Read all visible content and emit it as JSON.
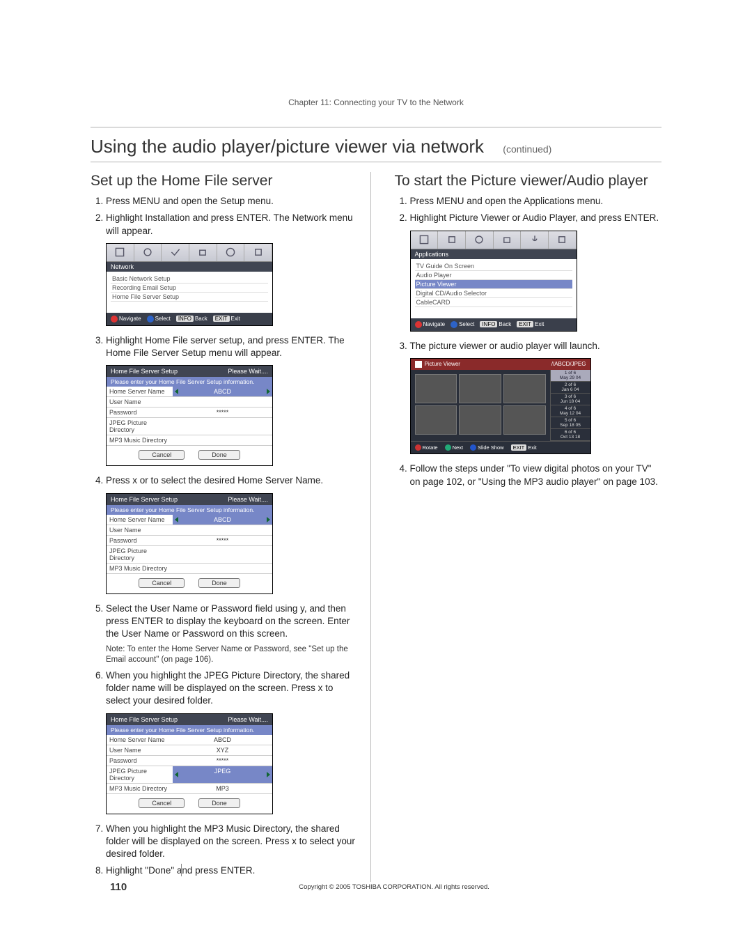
{
  "chapter": "Chapter 11: Connecting your TV to the Network",
  "title_main": "Using the audio player/picture viewer via network",
  "title_cont": "(continued)",
  "left": {
    "heading": "Set up the Home File server",
    "steps": {
      "s1": "Press MENU and open the Setup menu.",
      "s2": "Highlight Installation and press ENTER. The Network menu will appear.",
      "s3": "Highlight Home File server setup, and press ENTER. The Home File Server Setup menu will appear.",
      "s4": "Press x or  to select the desired Home Server Name.",
      "s5": "Select the User Name or Password field using y, and then press ENTER to display the keyboard on the screen. Enter the User Name or Password on this screen.",
      "s6": "When you highlight the JPEG Picture Directory, the shared folder name will be displayed on the screen. Press x to select your desired folder.",
      "s7": "When you highlight the MP3 Music Directory, the shared folder will be displayed on the screen. Press x to select your desired folder.",
      "s8": "Highlight \"Done\" and press ENTER."
    },
    "note": "Note: To enter the Home Server Name or Password, see \"Set up the Email account\" (on page 106).",
    "ui1": {
      "section": "Network",
      "items": [
        "Basic Network Setup",
        "Recording Email Setup",
        "Home File Server Setup"
      ],
      "footer": {
        "nav": "Navigate",
        "sel": "Select",
        "back_key": "INFO",
        "back": "Back",
        "exit_key": "EXIT",
        "exit": "Exit"
      }
    },
    "dlg": {
      "title": "Home File Server Setup",
      "wait": "Please Wait....",
      "sub": "Please enter your Home File Server Setup information.",
      "rows": {
        "home_server": "Home Server Name",
        "user_name": "User Name",
        "password": "Password",
        "jpeg_dir": "JPEG Picture Directory",
        "mp3_dir": "MP3 Music Directory"
      },
      "vals1": {
        "home_server": "ABCD",
        "user_name": "",
        "password": "*****",
        "jpeg_dir": "",
        "mp3_dir": ""
      },
      "vals2": {
        "home_server": "ABCD",
        "user_name": "",
        "password": "*****",
        "jpeg_dir": "",
        "mp3_dir": ""
      },
      "vals3": {
        "home_server": "ABCD",
        "user_name": "XYZ",
        "password": "*****",
        "jpeg_dir": "JPEG",
        "mp3_dir": "MP3"
      },
      "cancel": "Cancel",
      "done": "Done"
    }
  },
  "right": {
    "heading": "To start the Picture viewer/Audio player",
    "steps": {
      "s1": "Press MENU and open the Applications menu.",
      "s2": "Highlight Picture Viewer or Audio Player, and press ENTER.",
      "s3": "The picture viewer or audio player will launch.",
      "s4": "Follow the steps under \"To view digital photos on your TV\" on page 102, or \"Using the MP3 audio player\" on page 103."
    },
    "ui2": {
      "section": "Applications",
      "items": [
        "TV Guide On Screen",
        "Audio Player",
        "Picture Viewer",
        "Digital CD/Audio Selector",
        "CableCARD"
      ],
      "sel_index": 2,
      "footer": {
        "nav": "Navigate",
        "sel": "Select",
        "back_key": "INFO",
        "back": "Back",
        "exit_key": "EXIT",
        "exit": "Exit"
      }
    },
    "pv": {
      "title": "Picture Viewer",
      "path": "//ABCD/JPEG",
      "side": [
        {
          "a": "1 of 6",
          "b": "May 29 04"
        },
        {
          "a": "2 of 6",
          "b": "Jan 6 04"
        },
        {
          "a": "3 of 6",
          "b": "Jun 18 04"
        },
        {
          "a": "4 of 6",
          "b": "May 12 04"
        },
        {
          "a": "5 of 6",
          "b": "Sep 18 05"
        },
        {
          "a": "6 of 6",
          "b": "Oct 13 18"
        }
      ],
      "footer": {
        "rotate": "Rotate",
        "next": "Next",
        "slide": "Slide Show",
        "exit_key": "EXIT",
        "exit": "Exit"
      }
    }
  },
  "page_number": "110",
  "copyright": "Copyright © 2005 TOSHIBA CORPORATION. All rights reserved."
}
